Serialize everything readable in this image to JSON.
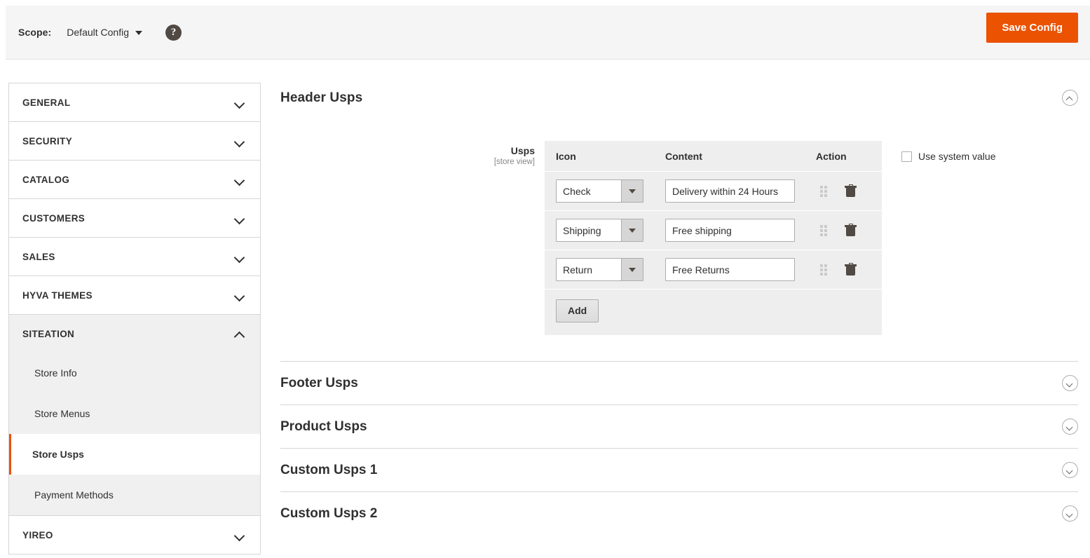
{
  "scope_bar": {
    "label": "Scope:",
    "value": "Default Config",
    "help_icon": "question-mark-icon",
    "save_label": "Save Config",
    "accent_color": "#eb5202"
  },
  "sidebar": {
    "sections": [
      {
        "label": "GENERAL",
        "open": false
      },
      {
        "label": "SECURITY",
        "open": false
      },
      {
        "label": "CATALOG",
        "open": false
      },
      {
        "label": "CUSTOMERS",
        "open": false
      },
      {
        "label": "SALES",
        "open": false
      },
      {
        "label": "HYVA THEMES",
        "open": false
      },
      {
        "label": "SITEATION",
        "open": true
      },
      {
        "label": "YIREO",
        "open": false
      }
    ],
    "siteation_items": [
      {
        "label": "Store Info",
        "active": false
      },
      {
        "label": "Store Menus",
        "active": false
      },
      {
        "label": "Store Usps",
        "active": true
      },
      {
        "label": "Payment Methods",
        "active": false
      }
    ]
  },
  "main": {
    "open_section": {
      "title": "Header Usps",
      "toggle_icon": "chevron-up-circle-icon"
    },
    "field": {
      "label": "Usps",
      "scope_note": "[store view]",
      "columns": [
        "Icon",
        "Content",
        "Action"
      ],
      "rows": [
        {
          "icon": "Check",
          "content": "Delivery within 24 Hours"
        },
        {
          "icon": "Shipping",
          "content": "Free shipping"
        },
        {
          "icon": "Return",
          "content": "Free Returns"
        }
      ],
      "add_label": "Add",
      "use_system_value": {
        "label": "Use system value",
        "checked": false
      }
    },
    "collapsed_sections": [
      {
        "title": "Footer Usps",
        "toggle_icon": "chevron-down-circle-icon"
      },
      {
        "title": "Product Usps",
        "toggle_icon": "chevron-down-circle-icon"
      },
      {
        "title": "Custom Usps 1",
        "toggle_icon": "chevron-down-circle-icon"
      },
      {
        "title": "Custom Usps 2",
        "toggle_icon": "chevron-down-circle-icon"
      }
    ]
  }
}
